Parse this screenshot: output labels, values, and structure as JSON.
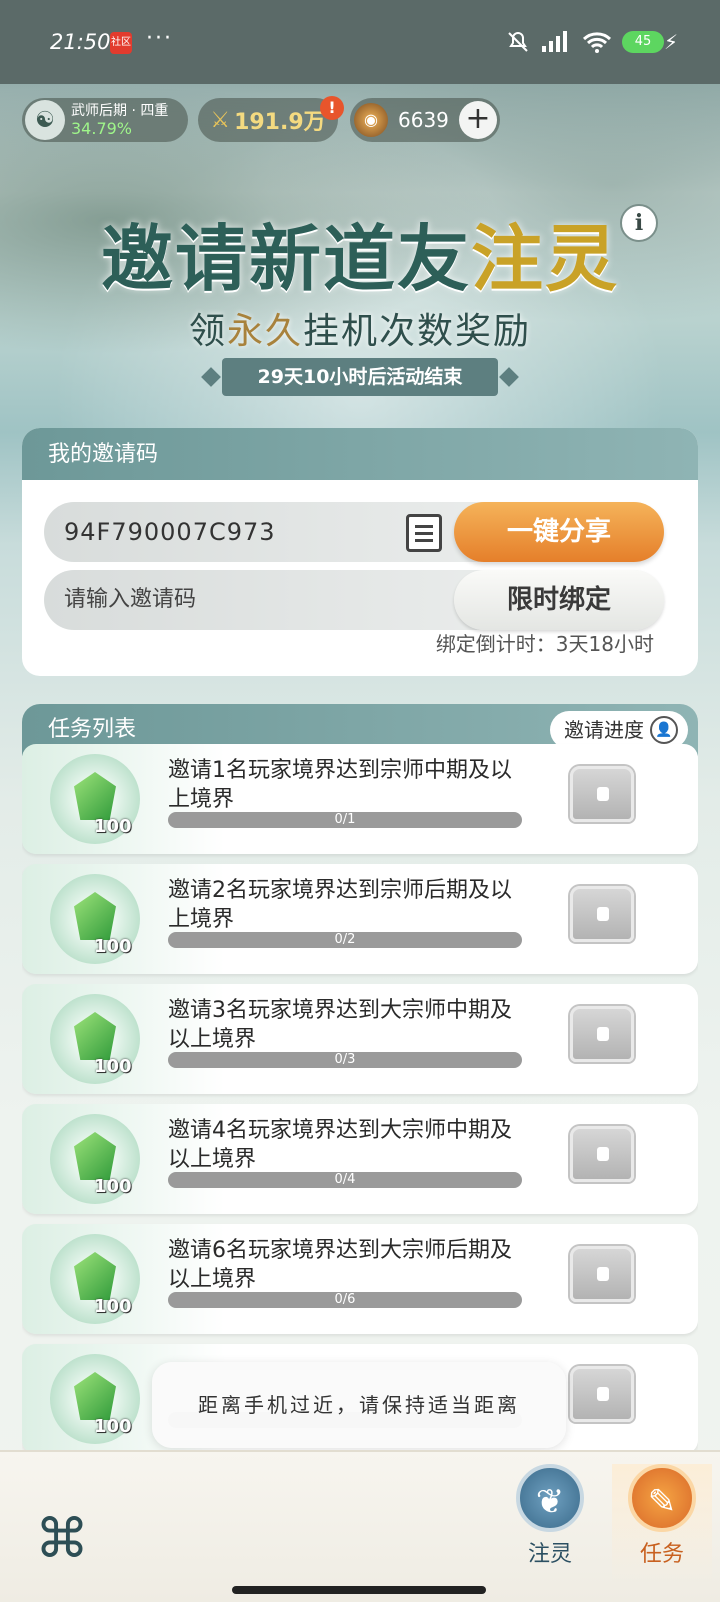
{
  "status_bar": {
    "time": "21:50",
    "app_badge": "社区",
    "more": "···",
    "battery": "45"
  },
  "resources": {
    "realm": "武师后期 · 四重",
    "realm_progress": "34.79%",
    "power": "191.9万",
    "alert": "!",
    "currency": "6639",
    "add": "+"
  },
  "banner": {
    "title_a": "邀请新道友",
    "title_b": "注灵",
    "info": "i",
    "subtitle_a": "领",
    "subtitle_b": "永久",
    "subtitle_c": "挂机次数奖励",
    "countdown": "29天10小时后活动结束"
  },
  "invite": {
    "header": "我的邀请码",
    "code": "94F790007C973",
    "share_label": "一键分享",
    "input_placeholder": "请输入邀请码",
    "bind_label": "限时绑定",
    "bind_countdown": "绑定倒计时：3天18小时"
  },
  "tasks": {
    "header": "任务列表",
    "progress_button": "邀请进度",
    "items": [
      {
        "desc": "邀请1名玩家境界达到宗师中期及以上境界",
        "reward": "100",
        "progress_text": "0/1",
        "progress": 0
      },
      {
        "desc": "邀请2名玩家境界达到宗师后期及以上境界",
        "reward": "100",
        "progress_text": "0/2",
        "progress": 0
      },
      {
        "desc": "邀请3名玩家境界达到大宗师中期及以上境界",
        "reward": "100",
        "progress_text": "0/3",
        "progress": 0
      },
      {
        "desc": "邀请4名玩家境界达到大宗师中期及以上境界",
        "reward": "100",
        "progress_text": "0/4",
        "progress": 0
      },
      {
        "desc": "邀请6名玩家境界达到大宗师后期及以上境界",
        "reward": "100",
        "progress_text": "0/6",
        "progress": 0
      },
      {
        "desc": "",
        "reward": "100",
        "progress_text": "",
        "progress": 0
      }
    ]
  },
  "toast": "距离手机过近，请保持适当距离",
  "nav": {
    "tab1": "注灵",
    "tab2": "任务"
  }
}
